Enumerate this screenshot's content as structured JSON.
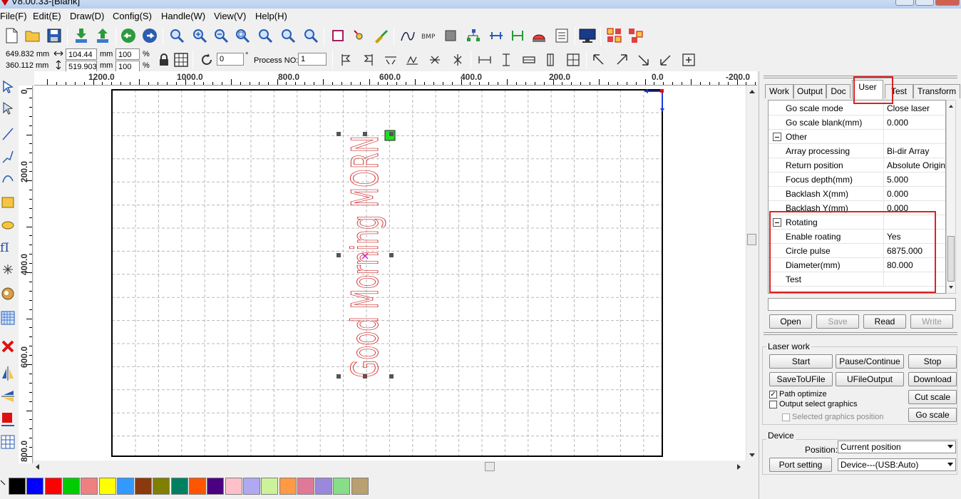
{
  "title": "V8.00.33-[Blank]",
  "menu": [
    "File(F)",
    "Edit(E)",
    "Draw(D)",
    "Config(S)",
    "Handle(W)",
    "View(V)",
    "Help(H)"
  ],
  "toolbar2": {
    "pos_x": "649.832 mm",
    "pos_y": "360.112 mm",
    "width": "104.44",
    "height": "519.903",
    "width_unit": "mm",
    "height_unit": "mm",
    "scale_x": "100",
    "scale_y": "100",
    "percent": "%",
    "angle": "0",
    "degree": "°",
    "process_no_label": "Process NO:",
    "process_no": "1"
  },
  "ruler_h": [
    "1200.0",
    "1000.0",
    "800.0",
    "600.0",
    "400.0",
    "200.0",
    "0.0",
    "-200.0"
  ],
  "ruler_v": [
    "0",
    "200.0",
    "400.0",
    "600.0",
    "800.0"
  ],
  "canvas": {
    "text": "Good Morning MORN",
    "text_color": "#d03030"
  },
  "tabs": [
    "Work",
    "Output",
    "Doc",
    "User",
    "Test",
    "Transform"
  ],
  "active_tab": "User",
  "properties": [
    {
      "key": "Go scale mode",
      "value": "Close laser"
    },
    {
      "key": "Go scale blank(mm)",
      "value": "0.000"
    },
    {
      "key": "Other",
      "value": "",
      "category": true
    },
    {
      "key": "Array processing",
      "value": "Bi-dir Array"
    },
    {
      "key": "Return position",
      "value": "Absolute Origin"
    },
    {
      "key": "Focus depth(mm)",
      "value": "5.000"
    },
    {
      "key": "Backlash X(mm)",
      "value": "0.000"
    },
    {
      "key": "Backlash Y(mm)",
      "value": "0.000"
    },
    {
      "key": "Rotating",
      "value": "",
      "category": true
    },
    {
      "key": "Enable roating",
      "value": "Yes"
    },
    {
      "key": "Circle pulse",
      "value": "6875.000"
    },
    {
      "key": "Diameter(mm)",
      "value": "80.000"
    },
    {
      "key": "Test",
      "value": ""
    }
  ],
  "file_buttons": {
    "open": "Open",
    "save": "Save",
    "read": "Read",
    "write": "Write"
  },
  "laser_work": {
    "title": "Laser work",
    "start": "Start",
    "pause": "Pause/Continue",
    "stop": "Stop",
    "save_to_ufile": "SaveToUFile",
    "ufile_output": "UFileOutput",
    "download": "Download",
    "path_optimize": "Path optimize",
    "output_select": "Output select graphics",
    "selected_pos": "Selected graphics position",
    "cut_scale": "Cut scale",
    "go_scale": "Go scale"
  },
  "device": {
    "title": "Device",
    "position_label": "Position:",
    "position_value": "Current position",
    "port_setting": "Port setting",
    "device_value": "Device---(USB:Auto)"
  },
  "palette": [
    "#000000",
    "#0000ff",
    "#ff0000",
    "#00cc00",
    "#f08080",
    "#ffff00",
    "#3399ff",
    "#8b3a0f",
    "#808000",
    "#008060",
    "#ff5500",
    "#4b0082",
    "#ffc0cb",
    "#b0a8f0",
    "#ccf29a",
    "#ff9944",
    "#e07898",
    "#9a88dd",
    "#88dd88",
    "#b8a070"
  ]
}
